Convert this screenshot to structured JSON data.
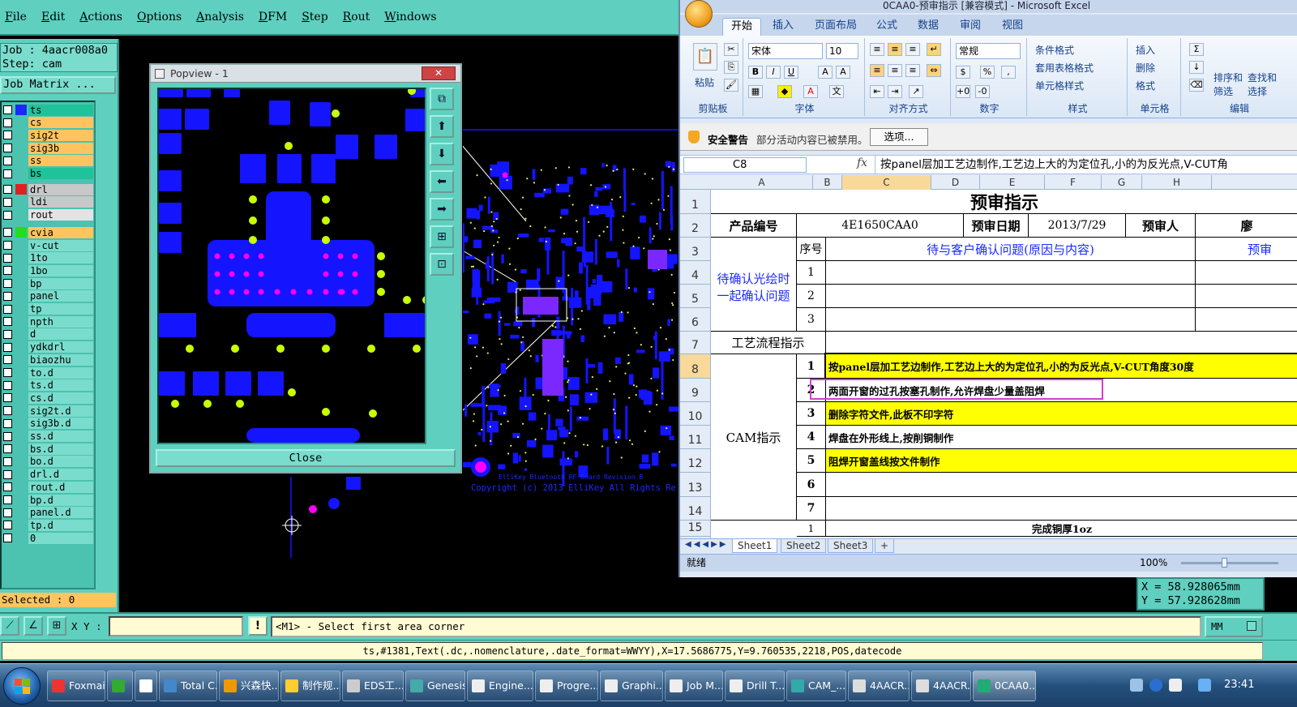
{
  "genesis": {
    "menu": [
      "File",
      "Edit",
      "Actions",
      "Options",
      "Analysis",
      "DFM",
      "Step",
      "Rout",
      "Windows"
    ],
    "job_line": "Job : 4aacr008a0",
    "step_line": "Step: cam",
    "job_matrix_button": "Job Matrix ...",
    "layers": [
      {
        "name": "ts",
        "swatch": "#1a2aff",
        "bg": "#1ec39a"
      },
      {
        "name": "cs",
        "swatch": "",
        "bg": "#ffc45f"
      },
      {
        "name": "sig2t",
        "swatch": "",
        "bg": "#ffc45f"
      },
      {
        "name": "sig3b",
        "swatch": "",
        "bg": "#ffc45f"
      },
      {
        "name": "ss",
        "swatch": "",
        "bg": "#ffc45f"
      },
      {
        "name": "bs",
        "swatch": "",
        "bg": "#1ec39a"
      },
      {
        "name": "drl",
        "swatch": "#e02020",
        "bg": "#c8c8c8"
      },
      {
        "name": "ldi",
        "swatch": "",
        "bg": "#c8c8c8"
      },
      {
        "name": "rout",
        "swatch": "",
        "bg": "#e3e3e3"
      },
      {
        "name": "cvia",
        "swatch": "#22dd22",
        "bg": "#ffc45f"
      },
      {
        "name": "v-cut",
        "swatch": "",
        "bg": "#7adccc"
      },
      {
        "name": "1to",
        "swatch": "",
        "bg": "#7adccc"
      },
      {
        "name": "1bo",
        "swatch": "",
        "bg": "#7adccc"
      },
      {
        "name": "bp",
        "swatch": "",
        "bg": "#7adccc"
      },
      {
        "name": "panel",
        "swatch": "",
        "bg": "#7adccc"
      },
      {
        "name": "tp",
        "swatch": "",
        "bg": "#7adccc"
      },
      {
        "name": "npth",
        "swatch": "",
        "bg": "#7adccc"
      },
      {
        "name": "d",
        "swatch": "",
        "bg": "#7adccc"
      },
      {
        "name": "ydkdrl",
        "swatch": "",
        "bg": "#7adccc"
      },
      {
        "name": "biaozhu",
        "swatch": "",
        "bg": "#7adccc"
      },
      {
        "name": "to.d",
        "swatch": "",
        "bg": "#7adccc"
      },
      {
        "name": "ts.d",
        "swatch": "",
        "bg": "#7adccc"
      },
      {
        "name": "cs.d",
        "swatch": "",
        "bg": "#7adccc"
      },
      {
        "name": "sig2t.d",
        "swatch": "",
        "bg": "#7adccc"
      },
      {
        "name": "sig3b.d",
        "swatch": "",
        "bg": "#7adccc"
      },
      {
        "name": "ss.d",
        "swatch": "",
        "bg": "#7adccc"
      },
      {
        "name": "bs.d",
        "swatch": "",
        "bg": "#7adccc"
      },
      {
        "name": "bo.d",
        "swatch": "",
        "bg": "#7adccc"
      },
      {
        "name": "drl.d",
        "swatch": "",
        "bg": "#7adccc"
      },
      {
        "name": "rout.d",
        "swatch": "",
        "bg": "#7adccc"
      },
      {
        "name": "bp.d",
        "swatch": "",
        "bg": "#7adccc"
      },
      {
        "name": "panel.d",
        "swatch": "",
        "bg": "#7adccc"
      },
      {
        "name": "tp.d",
        "swatch": "",
        "bg": "#7adccc"
      },
      {
        "name": "0",
        "swatch": "",
        "bg": "#7adccc"
      }
    ],
    "selected": "Selected : 0",
    "popview": {
      "title": "Popview - 1",
      "close_label": "Close"
    },
    "canvas_text": {
      "line1": "ElliKey Bluetooth RF Board Revision B",
      "line2": "Copyright (c) 2013 ElliKey All Rights Re"
    },
    "xy_label": "X Y :",
    "prompt": "<M1> - Select first area corner",
    "units": "MM",
    "status": "ts,#1381,Text(.dc,.nomenclature,.date_format=WWYY),X=17.5686775,Y=9.760535,2218,POS,datecode",
    "coord_x": "X =  58.928065mm",
    "coord_y": "Y =  57.928628mm",
    "colors": {
      "panel": "#5fd0bf",
      "copper": "#1414ff",
      "via": "#c8ff00",
      "drill": "#ff00ff"
    }
  },
  "excel": {
    "title": "0CAA0-预审指示  [兼容模式] - Microsoft Excel",
    "tabs": [
      "开始",
      "插入",
      "页面布局",
      "公式",
      "数据",
      "审阅",
      "视图"
    ],
    "ribbon": {
      "paste": "粘贴",
      "clipboard": "剪贴板",
      "font_name": "宋体",
      "font_size": "10",
      "font_group": "字体",
      "align_group": "对齐方式",
      "number_format": "常规",
      "number_group": "数字",
      "cond_format": "条件格式",
      "table_format": "套用表格格式",
      "cell_style": "单元格样式",
      "style_group": "样式",
      "insert": "插入",
      "delete": "删除",
      "format": "格式",
      "cells_group": "单元格",
      "sort": "排序和",
      "sort2": "筛选",
      "find": "查找和",
      "find2": "选择",
      "edit_group": "编辑"
    },
    "security": {
      "label": "安全警告",
      "message": "部分活动内容已被禁用。",
      "options": "选项..."
    },
    "name_box": "C8",
    "formula": "按panel层加工艺边制作,工艺边上大的为定位孔,小的为反光点,V-CUT角",
    "columns": [
      "A",
      "B",
      "C",
      "D",
      "E",
      "F",
      "G",
      "H"
    ],
    "rows": [
      "1",
      "2",
      "3",
      "4",
      "5",
      "6",
      "7",
      "8",
      "9",
      "10",
      "11",
      "12",
      "13",
      "14",
      "15"
    ],
    "sheet": {
      "title": "预审指示",
      "product_label": "产品编号",
      "product_value": "4E1650CAA0",
      "date_label": "预审日期",
      "date_value": "2013/7/29",
      "reviewer_label": "预审人",
      "reviewer_value": "廖",
      "seq_label": "序号",
      "confirm_header": "待与客户确认问题(原因与内容)",
      "review_header": "预审",
      "confirm_group": "待确认光绘时一起确认问题",
      "confirm_line1": "待确认光绘时",
      "confirm_line2": "一起确认问题",
      "confirm_nums": [
        "1",
        "2",
        "3"
      ],
      "process_label": "工艺流程指示",
      "cam_label": "CAM指示",
      "cam_items": [
        {
          "no": "1",
          "text": "按panel层加工艺边制作,工艺边上大的为定位孔,小的为反光点,V-CUT角度30度",
          "highlight": true
        },
        {
          "no": "2",
          "text": "两面开窗的过孔按塞孔制作,允许焊盘少量盖阻焊",
          "highlight": false
        },
        {
          "no": "3",
          "text": "删除字符文件,此板不印字符",
          "highlight": true
        },
        {
          "no": "4",
          "text": "焊盘在外形线上,按削铜制作",
          "highlight": false
        },
        {
          "no": "5",
          "text": "阻焊开窗盖线按文件制作",
          "highlight": true
        },
        {
          "no": "6",
          "text": "",
          "highlight": false
        },
        {
          "no": "7",
          "text": "",
          "highlight": false
        }
      ],
      "row15_no": "1",
      "row15_text": "完成铜厚1oz"
    },
    "sheets": [
      "Sheet1",
      "Sheet2",
      "Sheet3"
    ],
    "status_ready": "就绪",
    "zoom": "100%"
  },
  "taskbar": {
    "items": [
      "Foxmail",
      "",
      "",
      "Total C...",
      "兴森快...",
      "制作规...",
      "EDS工...",
      "Genesis",
      "Engine...",
      "Progre...",
      "Graphi...",
      "Job M...",
      "Drill T...",
      "CAM_...",
      "4AACR...",
      "4AACR...",
      "0CAA0..."
    ],
    "clock": "23:41"
  }
}
